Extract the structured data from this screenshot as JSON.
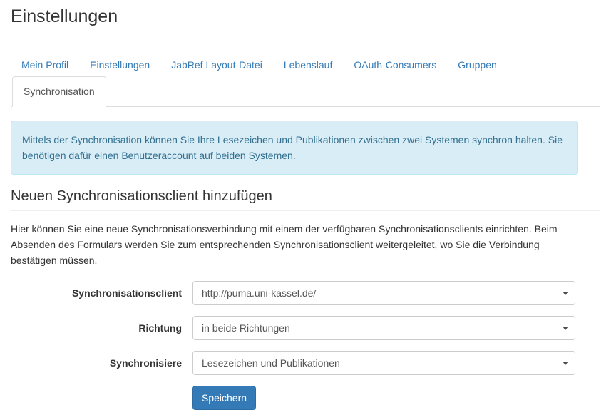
{
  "page": {
    "title": "Einstellungen"
  },
  "nav": {
    "links": [
      {
        "label": "Mein Profil"
      },
      {
        "label": "Einstellungen"
      },
      {
        "label": "JabRef Layout-Datei"
      },
      {
        "label": "Lebenslauf"
      },
      {
        "label": "OAuth-Consumers"
      },
      {
        "label": "Gruppen"
      }
    ],
    "active_tab": "Synchronisation"
  },
  "alert": {
    "type": "info",
    "text": "Mittels der Synchronisation können Sie Ihre Lesezeichen und Publikationen zwischen zwei Systemen synchron halten. Sie benötigen dafür einen Benutzeraccount auf beiden Systemen.",
    "background_color": "#d9edf7",
    "border_color": "#bce8f1",
    "text_color": "#31708f"
  },
  "section": {
    "heading": "Neuen Synchronisationsclient hinzufügen",
    "intro": "Hier können Sie eine neue Synchronisationsverbindung mit einem der verfügbaren Synchronisationsclients einrichten. Beim Absenden des Formulars werden Sie zum entsprechenden Synchronisationsclient weitergeleitet, wo Sie die Verbindung bestätigen müssen."
  },
  "form": {
    "fields": [
      {
        "label": "Synchronisationsclient",
        "value": "http://puma.uni-kassel.de/",
        "name": "sync-client"
      },
      {
        "label": "Richtung",
        "value": "in beide Richtungen",
        "name": "direction"
      },
      {
        "label": "Synchronisiere",
        "value": "Lesezeichen und Publikationen",
        "name": "sync-scope"
      }
    ],
    "submit_label": "Speichern",
    "submit_color": "#337ab7"
  },
  "icons": {
    "caret": "chevron-down-icon"
  }
}
